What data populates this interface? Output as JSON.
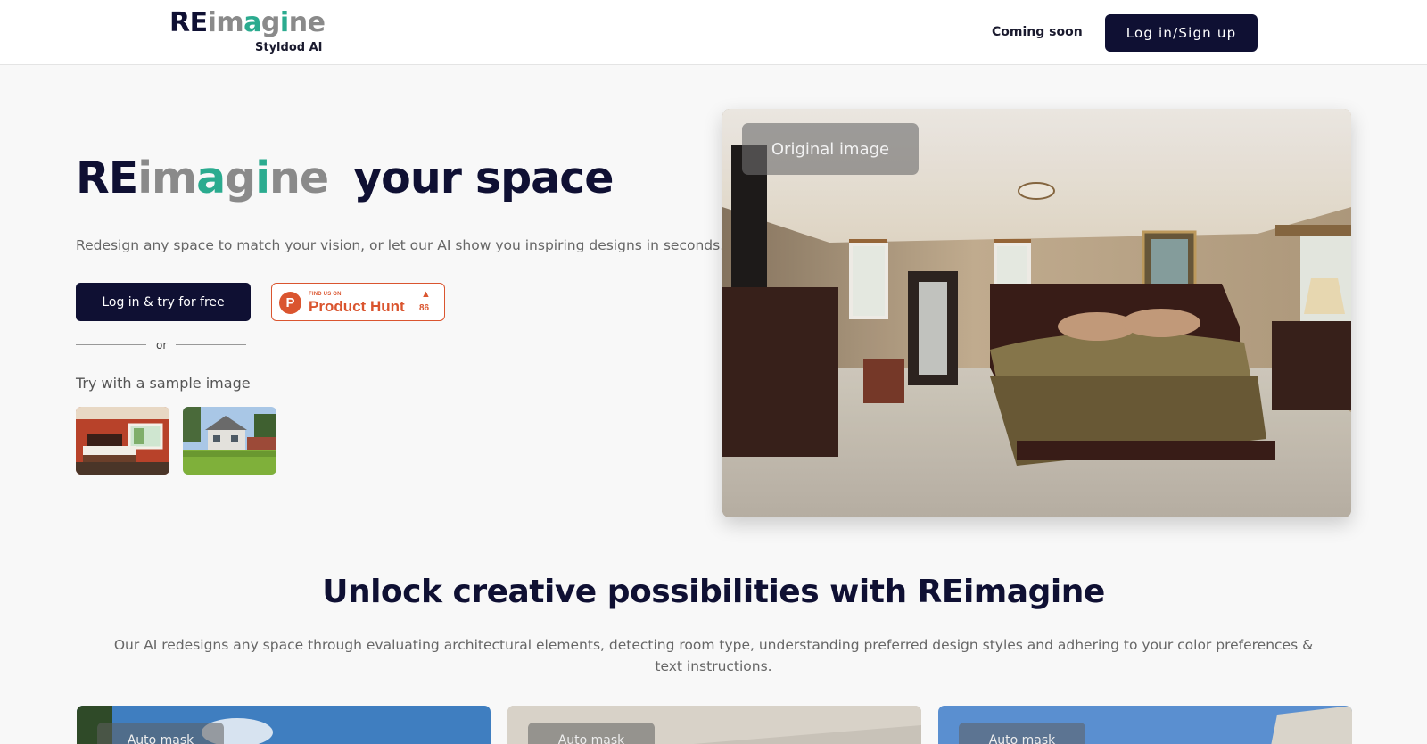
{
  "header": {
    "logo_letters": [
      "R",
      "E",
      "i",
      "m",
      "a",
      "g",
      "i",
      "n",
      "e"
    ],
    "logo_sub": "Styldod AI",
    "coming_soon": "Coming soon",
    "login_label": "Log in/Sign up"
  },
  "hero": {
    "title_brand_letters": [
      "R",
      "E",
      "i",
      "m",
      "a",
      "g",
      "i",
      "n",
      "e"
    ],
    "title_rest": "your space",
    "subtitle": "Redesign any space to match your vision, or let our AI show you inspiring designs in seconds.",
    "try_label": "Log in & try for free",
    "product_hunt": {
      "logo_letter": "P",
      "find_text": "FIND US ON",
      "name": "Product Hunt",
      "arrow": "▲",
      "count": "86"
    },
    "or_text": "or",
    "sample_label": "Try with a sample image",
    "image_label": "Original image"
  },
  "features": {
    "title": "Unlock creative possibilities with REimagine",
    "description": "Our AI redesigns any space through evaluating architectural elements, detecting room type, understanding preferred design styles and adhering to your color preferences & text instructions.",
    "cards": [
      {
        "label": "Auto mask"
      },
      {
        "label": "Auto mask"
      },
      {
        "label": "Auto mask"
      }
    ]
  },
  "colors": {
    "dark": "#0f1033",
    "gray_letters": "#8a8a8a",
    "teal_letters": "#2bab8f",
    "product_hunt": "#da552f"
  }
}
